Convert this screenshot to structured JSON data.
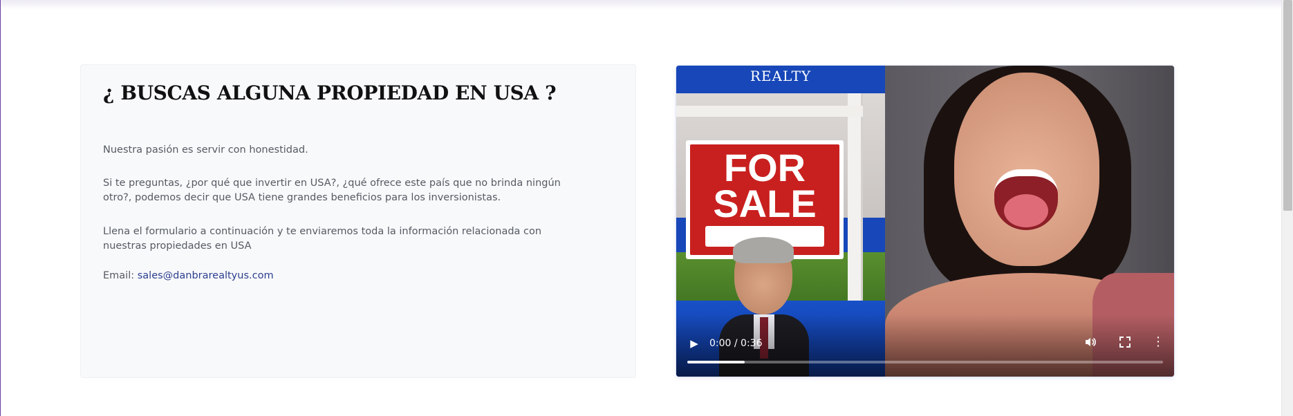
{
  "info": {
    "title": "¿ BUSCAS ALGUNA PROPIEDAD EN USA ?",
    "paragraph1": "Nuestra pasión es servir con honestidad.",
    "paragraph2": "Si te preguntas, ¿por qué que invertir en USA?, ¿qué ofrece este país que no brinda ningún otro?, podemos decir que USA tiene grandes beneficios para los inversionistas.",
    "paragraph3": "Llena el formulario a continuación y te enviaremos toda la información relacionada con nuestras propiedades en USA",
    "email_label": "Email:",
    "email": "sales@danbrarealtyus.com"
  },
  "video": {
    "brand_text": "REALTY",
    "sign_line1": "FOR",
    "sign_line2": "SALE",
    "time_display": "0:00 / 0:36",
    "progress": 0.12,
    "icons": {
      "play": "play-icon",
      "volume": "volume-icon",
      "fullscreen": "fullscreen-icon",
      "more": "more-options-icon"
    }
  },
  "colors": {
    "link": "#2b3f8e",
    "card_bg": "#f8f9fb",
    "sign_red": "#c8201f",
    "brand_blue": "#1747b8"
  }
}
